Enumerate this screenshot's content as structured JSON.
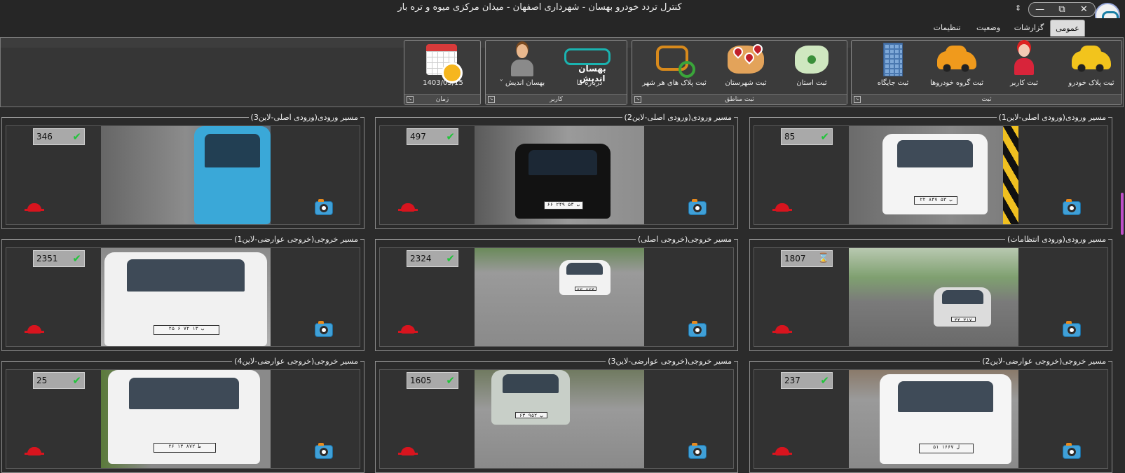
{
  "window": {
    "title": "کنترل تردد خودرو بهسان - شهرداری اصفهان - میدان مرکزی میوه و تره بار",
    "menu_glyph": "⇕",
    "controls": {
      "close": "✕",
      "restore": "⧉",
      "minimize": "—"
    },
    "logo_icon": "app-logo-icon"
  },
  "tabs": [
    {
      "label": "عمومی",
      "active": true
    },
    {
      "label": "گزارشات",
      "active": false
    },
    {
      "label": "وضعیت",
      "active": false
    },
    {
      "label": "تنظیمات",
      "active": false
    }
  ],
  "ribbon": {
    "groups": [
      {
        "label": "ثبت",
        "buttons": [
          {
            "label": "ثبت پلاک خودرو",
            "icon": "yellow-car-icon"
          },
          {
            "label": "ثبت کاربر",
            "icon": "user-icon"
          },
          {
            "label": "ثبت گروه خودروها",
            "icon": "car-group-icon"
          },
          {
            "label": "ثبت جایگاه",
            "icon": "building-icon"
          }
        ]
      },
      {
        "label": "ثبت مناطق",
        "buttons": [
          {
            "label": "ثبت استان",
            "icon": "iran-map-icon"
          },
          {
            "label": "ثبت شهرستان",
            "icon": "map-pins-icon"
          },
          {
            "label": "ثبت پلاک های هر شهر",
            "icon": "plate-search-icon"
          }
        ]
      },
      {
        "label": "کاربر",
        "buttons": [
          {
            "label": "درباره ما",
            "icon": "behsan-logo-icon",
            "logo_text": "بهسان اندیش"
          },
          {
            "label": "بهسان  اندیش",
            "icon": "person-icon",
            "has_dropdown": true
          }
        ]
      },
      {
        "label": "زمان",
        "buttons": [
          {
            "label": "1403/05/15",
            "icon": "calendar-clock-icon"
          }
        ]
      }
    ]
  },
  "panels": [
    {
      "title": "مسیر ورودی(ورودی اصلی-لاین1)",
      "count": "85",
      "status": "ok"
    },
    {
      "title": "مسیر ورودی(ورودی اصلی-لاین2)",
      "count": "497",
      "status": "ok"
    },
    {
      "title": "مسیر ورودی(ورودی اصلی-لاین3)",
      "count": "346",
      "status": "ok"
    },
    {
      "title": "مسیر ورودی(ورودی انتظامات)",
      "count": "1807",
      "status": "wait"
    },
    {
      "title": "مسیر خروجی(خروجی اصلی)",
      "count": "2324",
      "status": "ok"
    },
    {
      "title": "مسیر خروجی(خروجی عوارضی-لاین1)",
      "count": "2351",
      "status": "ok"
    },
    {
      "title": "مسیر خروجی(خروجی عوارضی-لاین2)",
      "count": "237",
      "status": "ok"
    },
    {
      "title": "مسیر خروجی(خروجی عوارضی-لاین3)",
      "count": "1605",
      "status": "ok"
    },
    {
      "title": "مسیر خروجی(خروجی عوارضی-لاین4)",
      "count": "25",
      "status": "ok"
    }
  ],
  "plates": [
    "۲۲ ۸۴۷ ب ۵۳",
    "۶۶ ۲۴۹ ب ۵۳",
    "",
    "۴۴ ۳۱۷ ب ۲۳",
    "۶۳ ۶۲۴ ب ۵۳",
    "۲۵ ۶ ۷۲ ب ۱۳",
    "۵۱ ل ۱۶۶۷",
    "۶۳ ۹۵۲ ب ۵۳",
    "۲۶ ط ۸۷۲ ۱۳"
  ],
  "icons": {
    "ok": "✔",
    "wait": "⌛",
    "alarm": "alarm-light-icon",
    "camera": "camera-icon"
  },
  "colors": {
    "accent_ok": "#21c43a",
    "alarm": "#d8141e"
  }
}
